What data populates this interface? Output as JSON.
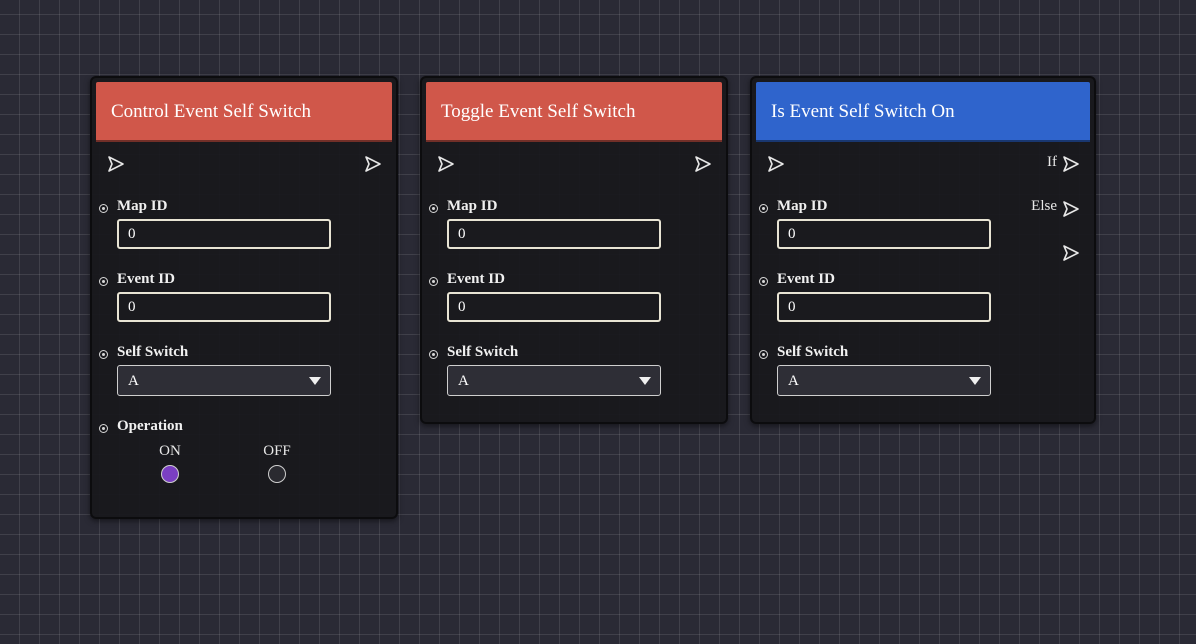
{
  "colors": {
    "action_header": "#d0574a",
    "condition_header": "#2f64cc",
    "radio_selected": "#7a3fc2"
  },
  "nodes": [
    {
      "title": "Control Event Self Switch",
      "fields": {
        "map_id": {
          "label": "Map ID",
          "value": "0"
        },
        "event_id": {
          "label": "Event ID",
          "value": "0"
        },
        "self_switch": {
          "label": "Self Switch",
          "value": "A"
        },
        "operation": {
          "label": "Operation",
          "options": [
            "ON",
            "OFF"
          ],
          "selected": "ON"
        }
      }
    },
    {
      "title": "Toggle Event Self Switch",
      "fields": {
        "map_id": {
          "label": "Map ID",
          "value": "0"
        },
        "event_id": {
          "label": "Event ID",
          "value": "0"
        },
        "self_switch": {
          "label": "Self Switch",
          "value": "A"
        }
      }
    },
    {
      "title": "Is Event Self Switch On",
      "outputs": {
        "if_label": "If",
        "else_label": "Else"
      },
      "fields": {
        "map_id": {
          "label": "Map ID",
          "value": "0"
        },
        "event_id": {
          "label": "Event ID",
          "value": "0"
        },
        "self_switch": {
          "label": "Self Switch",
          "value": "A"
        }
      }
    }
  ]
}
